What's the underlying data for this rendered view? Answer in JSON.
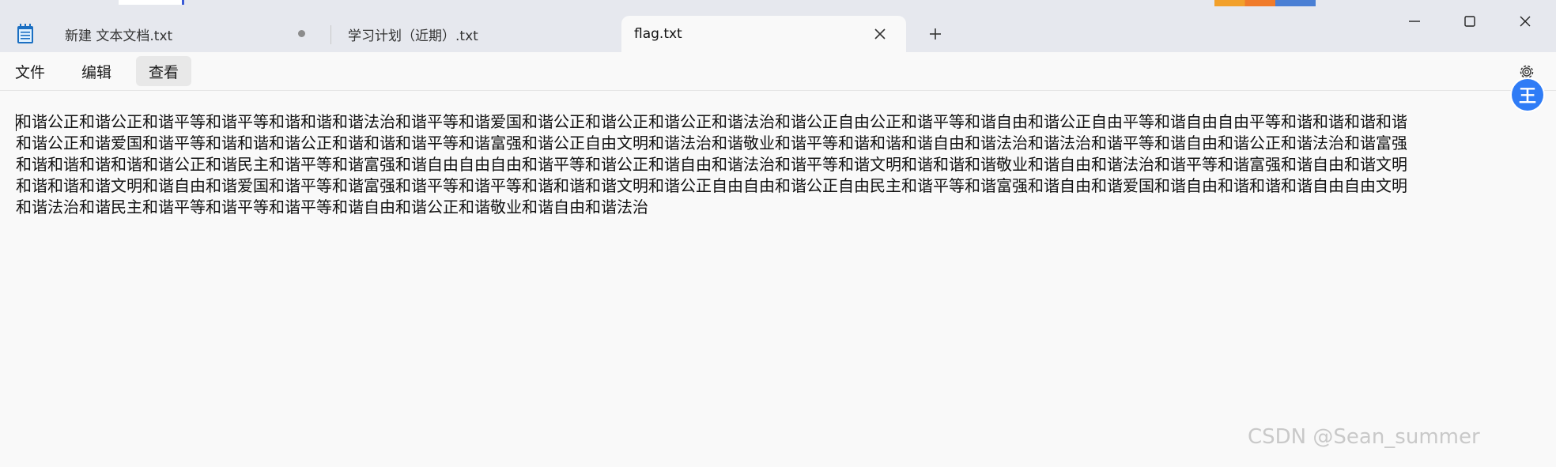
{
  "tabs": [
    {
      "label": "新建 文本文档.txt",
      "modified": true
    },
    {
      "label": "学习计划（近期）.txt",
      "modified": false
    },
    {
      "label": "flag.txt",
      "active": true
    }
  ],
  "menu": {
    "file": "文件",
    "edit": "编辑",
    "view": "查看"
  },
  "extension_badge": "王",
  "editor": {
    "lines": [
      "和谐公正和谐公正和谐平等和谐平等和谐和谐和谐法治和谐平等和谐爱国和谐公正和谐公正和谐公正和谐法治和谐公正自由公正和谐平等和谐自由和谐公正自由平等和谐自由自由平等和谐和谐和谐和谐",
      "和谐公正和谐爱国和谐平等和谐和谐和谐公正和谐和谐和谐平等和谐富强和谐公正自由文明和谐法治和谐敬业和谐平等和谐和谐和谐自由和谐法治和谐法治和谐平等和谐自由和谐公正和谐法治和谐富强",
      "和谐和谐和谐和谐和谐公正和谐民主和谐平等和谐富强和谐自由自由自由和谐平等和谐公正和谐自由和谐法治和谐平等和谐文明和谐和谐和谐敬业和谐自由和谐法治和谐平等和谐富强和谐自由和谐文明",
      "和谐和谐和谐文明和谐自由和谐爱国和谐平等和谐富强和谐平等和谐平等和谐和谐和谐文明和谐公正自由自由和谐公正自由民主和谐平等和谐富强和谐自由和谐爱国和谐自由和谐和谐和谐自由自由文明",
      "和谐法治和谐民主和谐平等和谐平等和谐平等和谐自由和谐公正和谐敬业和谐自由和谐法治"
    ]
  },
  "watermark": "CSDN @Sean_summer"
}
